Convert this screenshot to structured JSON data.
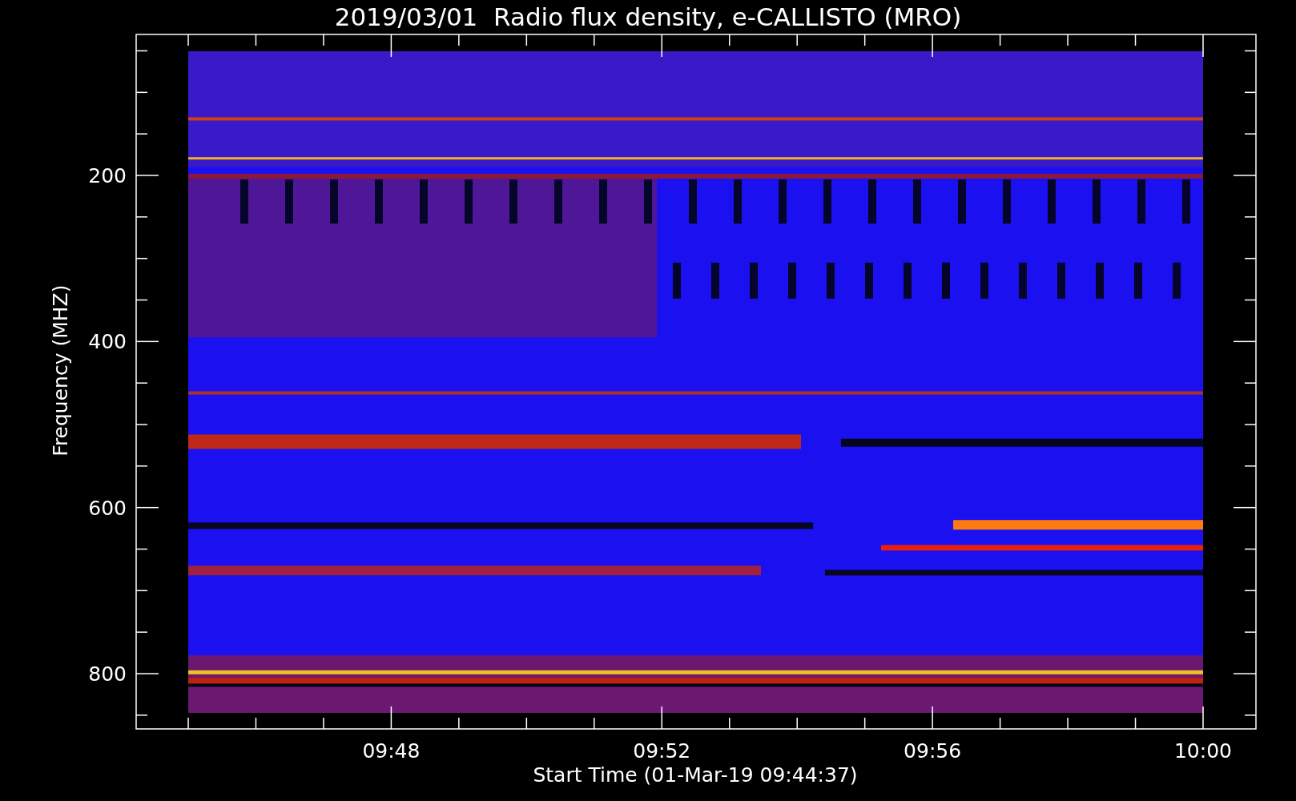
{
  "title": "2019/03/01  Radio flux density, e-CALLISTO (MRO)",
  "y_axis": {
    "label": "Frequency (MHZ)",
    "ticks": [
      "200",
      "400",
      "600",
      "800"
    ]
  },
  "x_axis": {
    "label": "Start Time (01-Mar-19 09:44:37)",
    "ticks": [
      "09:48",
      "09:52",
      "09:56",
      "10:00"
    ]
  }
}
